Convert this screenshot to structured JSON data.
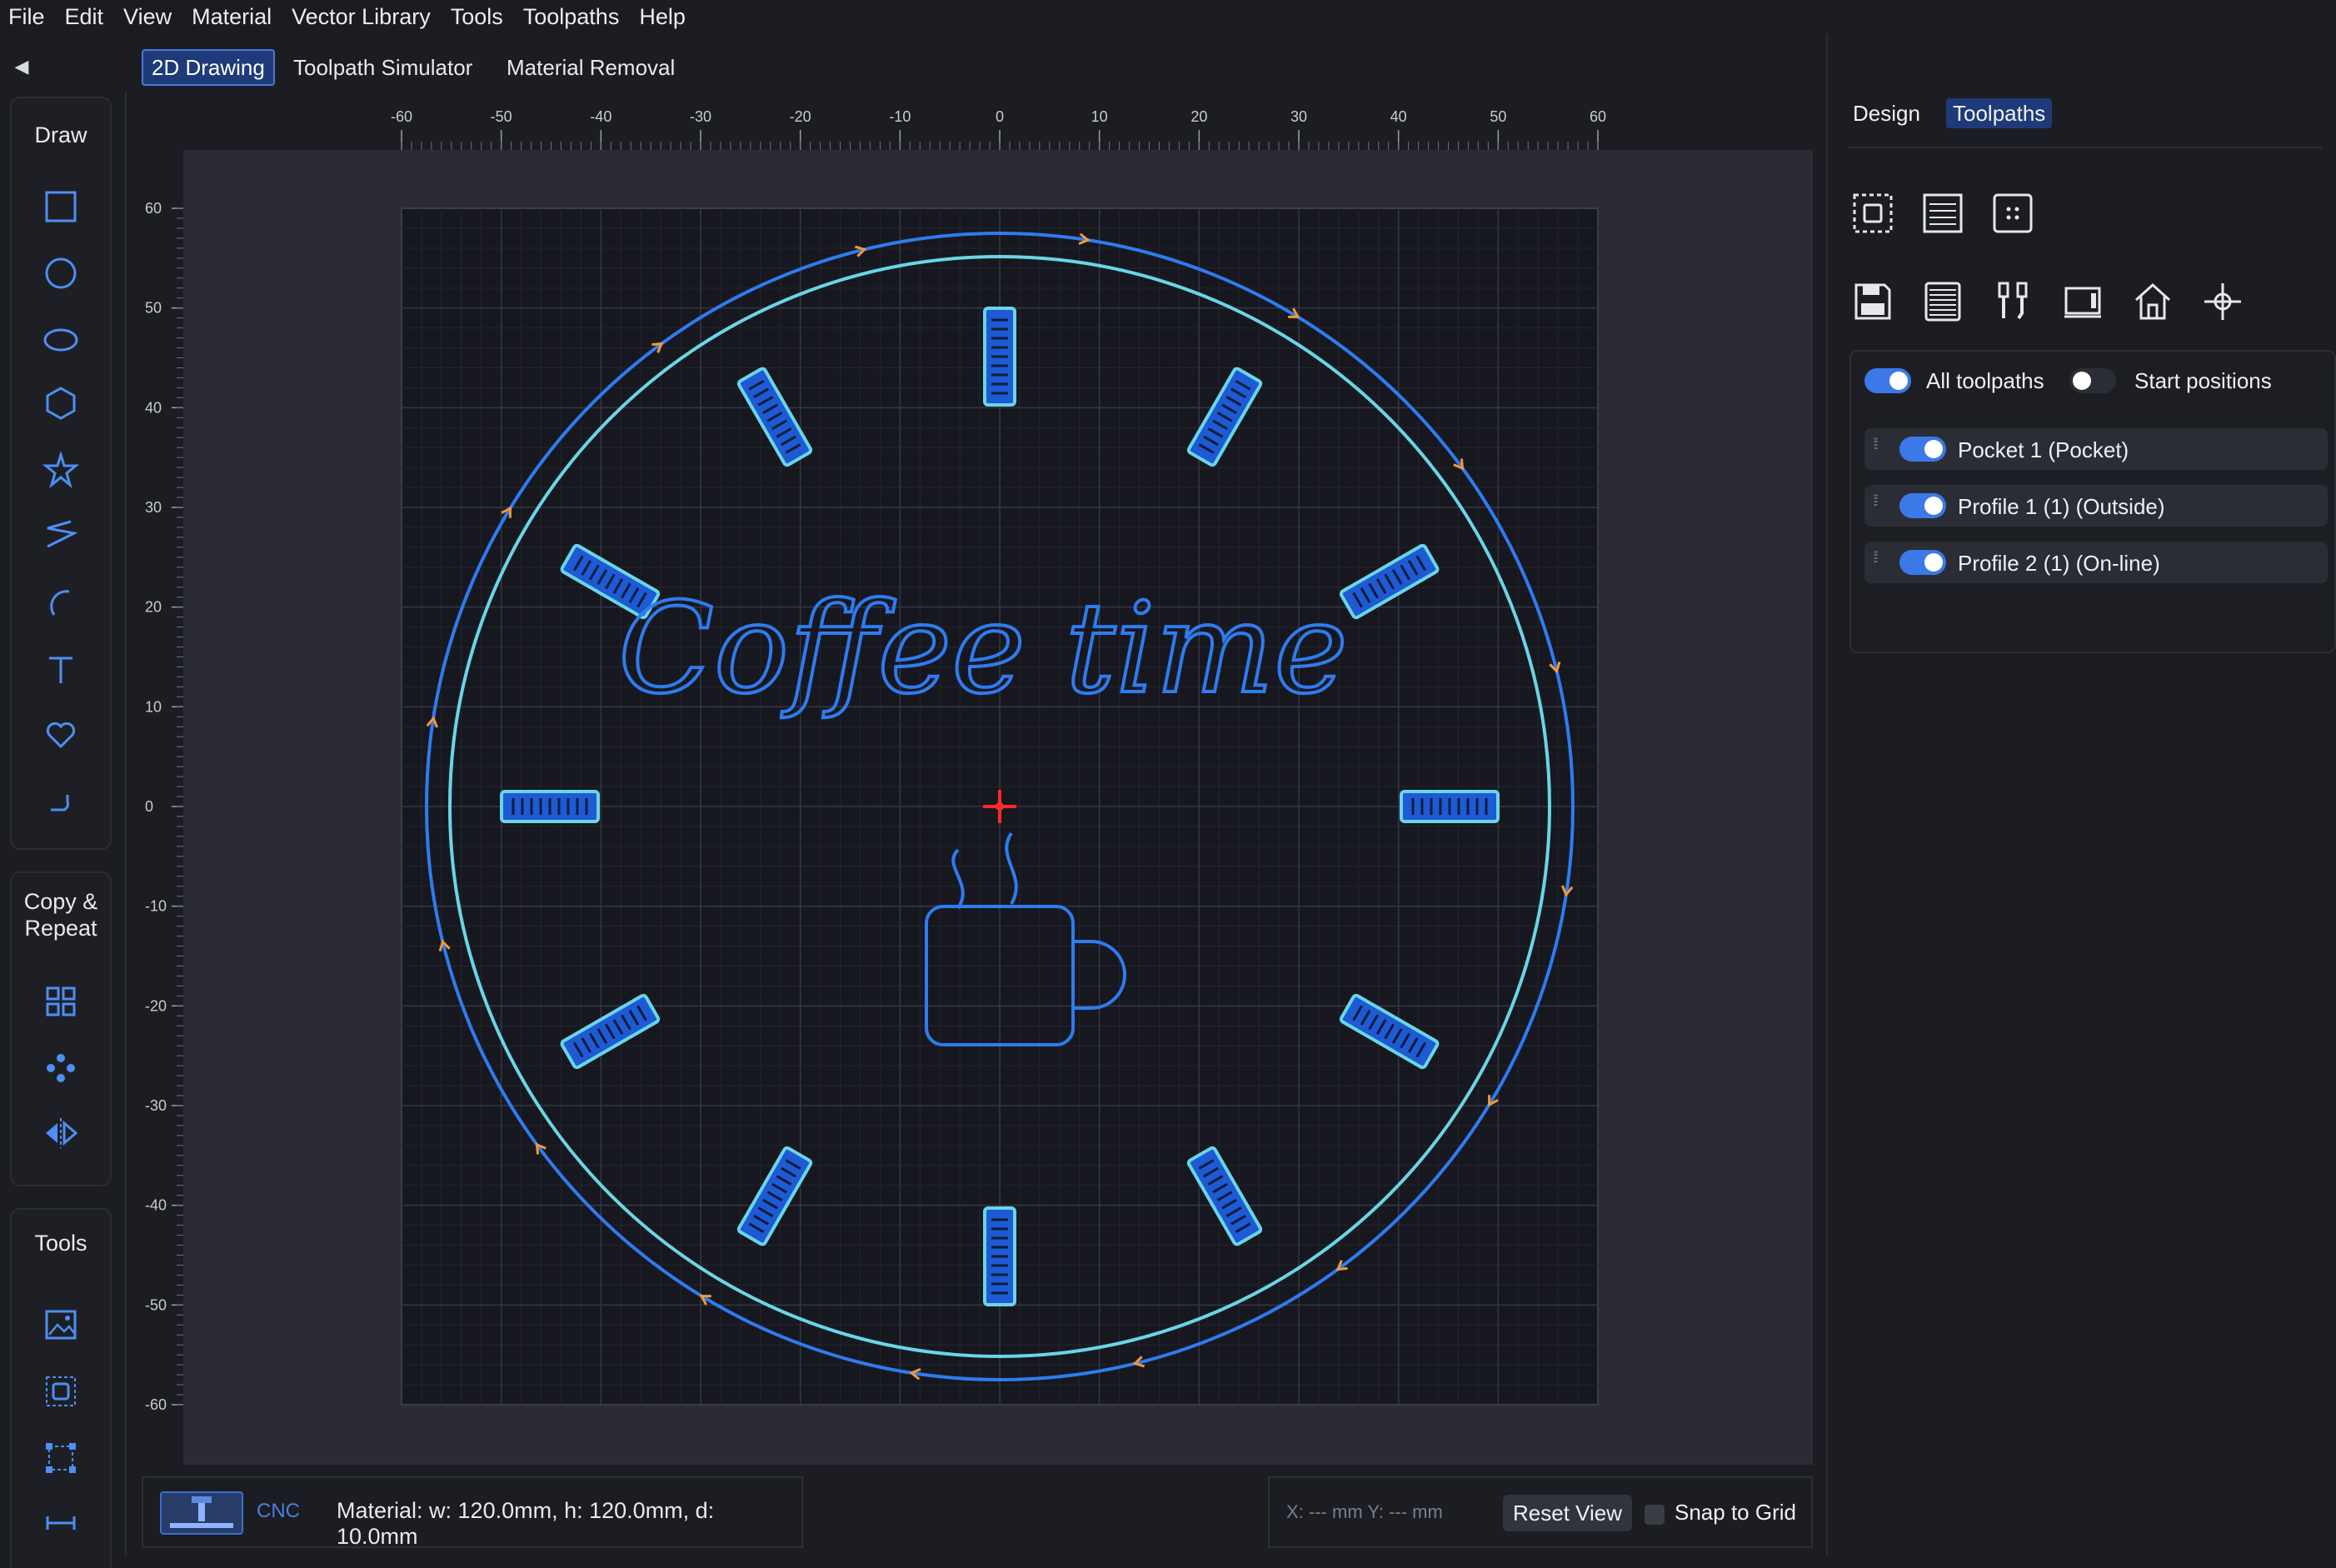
{
  "menubar": {
    "items": [
      "File",
      "Edit",
      "View",
      "Material",
      "Vector Library",
      "Tools",
      "Toolpaths",
      "Help"
    ]
  },
  "view_tabs": {
    "drawing": "2D Drawing",
    "simulator": "Toolpath Simulator",
    "removal": "Material Removal"
  },
  "left_panels": {
    "draw_title": "Draw",
    "copy_title": "Copy &\nRepeat",
    "tools_title": "Tools",
    "draw_tools": [
      "rectangle-icon",
      "circle-icon",
      "ellipse-icon",
      "hexagon-icon",
      "star-icon",
      "polyline-icon",
      "arc-icon",
      "text-icon",
      "heart-icon",
      "curve-icon"
    ],
    "copy_tools": [
      "grid-array-icon",
      "circular-array-icon",
      "mirror-icon"
    ],
    "other_tools": [
      "image-icon",
      "offset-icon",
      "bounding-box-icon",
      "measure-icon"
    ]
  },
  "canvas": {
    "x_ticks": [
      "-60",
      "-50",
      "-40",
      "-30",
      "-20",
      "-10",
      "0",
      "10",
      "20",
      "30",
      "40",
      "50",
      "60"
    ],
    "y_ticks": [
      "60",
      "50",
      "40",
      "30",
      "20",
      "10",
      "0",
      "-10",
      "-20",
      "-30",
      "-40",
      "-50",
      "-60"
    ],
    "text_shape": "Coffee time",
    "colors": {
      "outer_profile": "#2f7bf0",
      "inner_profile": "#6ad5e6",
      "pocket_fill": "#1d5ad4",
      "direction_arrow": "#f29a36",
      "origin": "#ff2a2a"
    }
  },
  "status": {
    "machine": "CNC",
    "material": "Material: w: 120.0mm, h: 120.0mm, d: 10.0mm",
    "coords": "X: --- mm  Y: --- mm",
    "reset_view": "Reset View",
    "snap_to_grid": "Snap to Grid"
  },
  "right_panel": {
    "tabs": {
      "design": "Design",
      "toolpaths": "Toolpaths"
    },
    "toolbar_row1": [
      "select-area-icon",
      "list-icon",
      "dots-grid-icon"
    ],
    "toolbar_row2": [
      "save-icon",
      "gcode-icon",
      "tool-bits-icon",
      "machine-icon",
      "home-icon",
      "crosshair-icon"
    ],
    "all_toolpaths": "All toolpaths",
    "start_positions": "Start positions",
    "toolpaths": [
      {
        "label": "Pocket 1 (Pocket)"
      },
      {
        "label": "Profile 1 (1) (Outside)"
      },
      {
        "label": "Profile 2 (1) (On-line)"
      }
    ]
  }
}
